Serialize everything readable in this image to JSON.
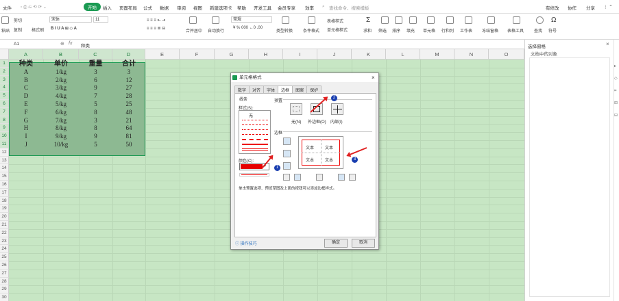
{
  "menubar": {
    "items": [
      "文件",
      "开始",
      "插入",
      "页面布局",
      "公式",
      "数据",
      "审阅",
      "视图",
      "新建选项卡",
      "帮助",
      "开发工具",
      "会员专享",
      "效率"
    ],
    "active": "开始",
    "search_placeholder": "查找命令、搜索模板",
    "right": [
      "有修改",
      "协作",
      "分享"
    ]
  },
  "ribbon": {
    "cut": "剪切",
    "paste": "粘贴",
    "copy": "复制",
    "format_painter": "格式刷",
    "font_name": "宋体",
    "font_size": "11",
    "merge": "合并居中",
    "wrap": "自动换行",
    "number_format": "常规",
    "type_convert": "类型转换",
    "cond_format": "条件格式",
    "table_style": "表格样式",
    "cell_style": "单元格样式",
    "sum": "求和",
    "filter": "筛选",
    "sort": "排序",
    "fill": "填充",
    "cell": "单元格",
    "rowcol": "行和列",
    "worksheet": "工作表",
    "freeze": "冻结窗格",
    "table_tools": "表格工具",
    "find": "查找",
    "symbol": "符号"
  },
  "formulabar": {
    "cellref": "A1",
    "fx": "fx",
    "value": "种类"
  },
  "columns": [
    "A",
    "B",
    "C",
    "D",
    "E",
    "F",
    "G",
    "H",
    "I",
    "J",
    "K",
    "L",
    "M",
    "N",
    "O"
  ],
  "rows": [
    "1",
    "2",
    "3",
    "4",
    "5",
    "6",
    "7",
    "8",
    "9",
    "10",
    "11",
    "12",
    "13",
    "14",
    "15",
    "16",
    "17",
    "18",
    "19",
    "20",
    "21",
    "22",
    "23",
    "24",
    "25",
    "26",
    "27",
    "28",
    "29",
    "30"
  ],
  "table": {
    "headers": [
      "种类",
      "单价",
      "重量",
      "合计"
    ],
    "data": [
      [
        "A",
        "1/kg",
        "3",
        "3"
      ],
      [
        "B",
        "2/kg",
        "6",
        "12"
      ],
      [
        "C",
        "3/kg",
        "9",
        "27"
      ],
      [
        "D",
        "4/kg",
        "7",
        "28"
      ],
      [
        "E",
        "5/kg",
        "5",
        "25"
      ],
      [
        "F",
        "6/kg",
        "8",
        "48"
      ],
      [
        "G",
        "7/kg",
        "3",
        "21"
      ],
      [
        "H",
        "8/kg",
        "8",
        "64"
      ],
      [
        "I",
        "9/kg",
        "9",
        "81"
      ],
      [
        "J",
        "10/kg",
        "5",
        "50"
      ]
    ]
  },
  "dialog": {
    "title": "单元格格式",
    "tabs": [
      "数字",
      "对齐",
      "字体",
      "边框",
      "图案",
      "保护"
    ],
    "active_tab": "边框",
    "line_section": "线条",
    "style_label": "样式(S):",
    "style_none": "无",
    "color_label": "颜色(C):",
    "color_value": "#e60000",
    "preset_section": "预置",
    "preset_none": "无(N)",
    "preset_outline": "外边框(O)",
    "preset_inside": "内部(I)",
    "border_section": "边框",
    "preview_text": [
      "文本",
      "文本",
      "文本",
      "文本"
    ],
    "hint": "单击预置选项、预览草图及上面的按钮可以添加边框样式。",
    "tips_link": "操作技巧",
    "ok": "确定",
    "cancel": "取消",
    "badges": [
      "1",
      "2",
      "3"
    ]
  },
  "right_panel": {
    "title": "选择窗格",
    "subtitle": "文档中的对象"
  }
}
